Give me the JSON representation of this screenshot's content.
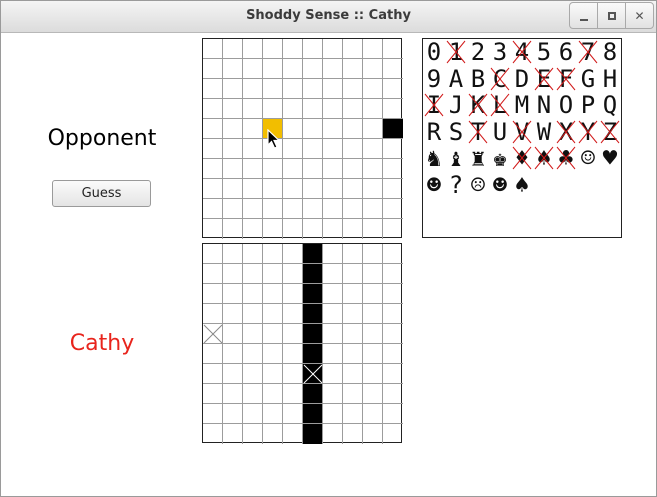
{
  "window": {
    "title": "Shoddy Sense :: Cathy"
  },
  "opponent": {
    "label": "Opponent",
    "guess_label": "Guess"
  },
  "player": {
    "name": "Cathy",
    "name_color": "#e8241c"
  },
  "colors": {
    "hover_cell": "#f2be00",
    "filled_cell": "#000000",
    "cross_out": "#d11a1a"
  },
  "opponent_grid": {
    "rows": 10,
    "cols": 10,
    "filled": [
      [
        4,
        9
      ]
    ],
    "hover": [
      [
        4,
        3
      ]
    ]
  },
  "my_grid": {
    "rows": 10,
    "cols": 10,
    "filled": [
      [
        0,
        5
      ],
      [
        1,
        5
      ],
      [
        2,
        5
      ],
      [
        3,
        5
      ],
      [
        4,
        5
      ],
      [
        5,
        5
      ],
      [
        6,
        5
      ],
      [
        7,
        5
      ],
      [
        8,
        5
      ],
      [
        9,
        5
      ]
    ],
    "crossed": [
      [
        4,
        0
      ],
      [
        6,
        5
      ]
    ]
  },
  "symbols": [
    {
      "glyph": "0",
      "eliminated": false
    },
    {
      "glyph": "1",
      "eliminated": true
    },
    {
      "glyph": "2",
      "eliminated": false
    },
    {
      "glyph": "3",
      "eliminated": false
    },
    {
      "glyph": "4",
      "eliminated": true
    },
    {
      "glyph": "5",
      "eliminated": false
    },
    {
      "glyph": "6",
      "eliminated": false
    },
    {
      "glyph": "7",
      "eliminated": true
    },
    {
      "glyph": "8",
      "eliminated": false
    },
    {
      "glyph": "9",
      "eliminated": false
    },
    {
      "glyph": "A",
      "eliminated": false
    },
    {
      "glyph": "B",
      "eliminated": false
    },
    {
      "glyph": "C",
      "eliminated": true
    },
    {
      "glyph": "D",
      "eliminated": false
    },
    {
      "glyph": "E",
      "eliminated": true
    },
    {
      "glyph": "F",
      "eliminated": true
    },
    {
      "glyph": "G",
      "eliminated": false
    },
    {
      "glyph": "H",
      "eliminated": false
    },
    {
      "glyph": "I",
      "eliminated": true
    },
    {
      "glyph": "J",
      "eliminated": false
    },
    {
      "glyph": "K",
      "eliminated": true
    },
    {
      "glyph": "L",
      "eliminated": true
    },
    {
      "glyph": "M",
      "eliminated": false
    },
    {
      "glyph": "N",
      "eliminated": false
    },
    {
      "glyph": "O",
      "eliminated": false
    },
    {
      "glyph": "P",
      "eliminated": false
    },
    {
      "glyph": "Q",
      "eliminated": false
    },
    {
      "glyph": "R",
      "eliminated": false
    },
    {
      "glyph": "S",
      "eliminated": false
    },
    {
      "glyph": "T",
      "eliminated": true
    },
    {
      "glyph": "U",
      "eliminated": false
    },
    {
      "glyph": "V",
      "eliminated": true
    },
    {
      "glyph": "W",
      "eliminated": false
    },
    {
      "glyph": "X",
      "eliminated": true
    },
    {
      "glyph": "Y",
      "eliminated": true
    },
    {
      "glyph": "Z",
      "eliminated": true
    },
    {
      "glyph": "♞",
      "eliminated": false
    },
    {
      "glyph": "♝",
      "eliminated": false
    },
    {
      "glyph": "♜",
      "eliminated": false
    },
    {
      "glyph": "♚",
      "eliminated": false
    },
    {
      "glyph": "♦",
      "eliminated": true
    },
    {
      "glyph": "♠",
      "eliminated": true
    },
    {
      "glyph": "♣",
      "eliminated": true
    },
    {
      "glyph": "☺",
      "eliminated": false
    },
    {
      "glyph": "♥",
      "eliminated": false
    },
    {
      "glyph": "☻",
      "eliminated": false
    },
    {
      "glyph": "?",
      "eliminated": false
    },
    {
      "glyph": "☹",
      "eliminated": false
    },
    {
      "glyph": "☻",
      "eliminated": false
    },
    {
      "glyph": "♠",
      "eliminated": false
    }
  ]
}
